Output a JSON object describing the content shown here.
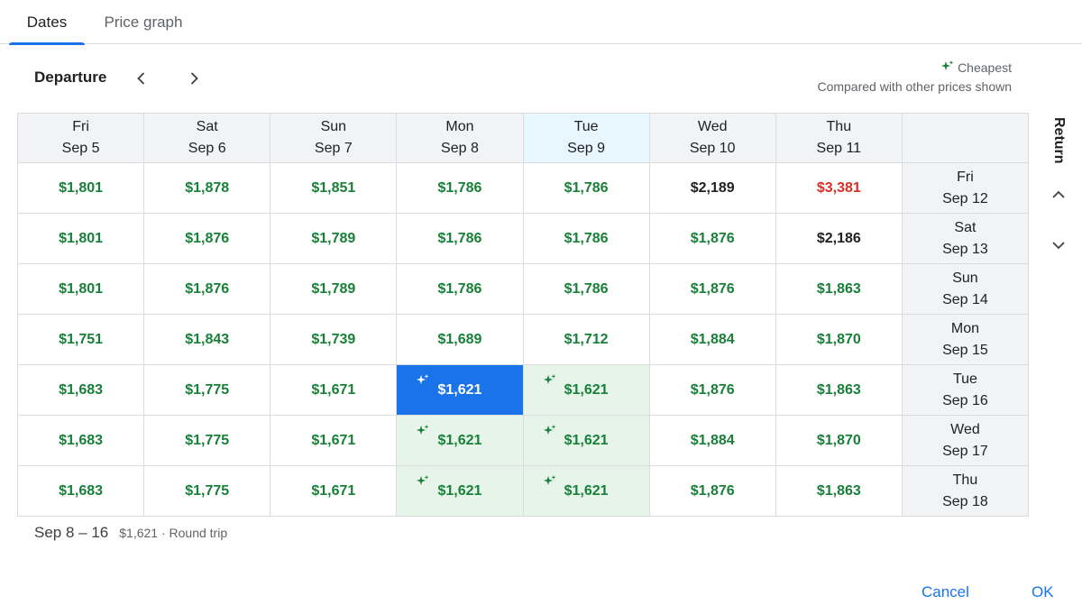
{
  "tabs": [
    {
      "label": "Dates"
    },
    {
      "label": "Price graph"
    }
  ],
  "departure_label": "Departure",
  "legend": {
    "cheapest": "Cheapest",
    "subtitle": "Compared with other prices shown"
  },
  "return_label": "Return",
  "columns": [
    {
      "day": "Fri",
      "date": "Sep 5"
    },
    {
      "day": "Sat",
      "date": "Sep 6"
    },
    {
      "day": "Sun",
      "date": "Sep 7"
    },
    {
      "day": "Mon",
      "date": "Sep 8"
    },
    {
      "day": "Tue",
      "date": "Sep 9"
    },
    {
      "day": "Wed",
      "date": "Sep 10"
    },
    {
      "day": "Thu",
      "date": "Sep 11"
    }
  ],
  "rows": [
    {
      "day": "Fri",
      "date": "Sep 12",
      "prices": [
        "$1,801",
        "$1,878",
        "$1,851",
        "$1,786",
        "$1,786",
        "$2,189",
        "$3,381"
      ],
      "tones": [
        "green",
        "green",
        "green",
        "green",
        "green",
        "black",
        "red"
      ]
    },
    {
      "day": "Sat",
      "date": "Sep 13",
      "prices": [
        "$1,801",
        "$1,876",
        "$1,789",
        "$1,786",
        "$1,786",
        "$1,876",
        "$2,186"
      ],
      "tones": [
        "green",
        "green",
        "green",
        "green",
        "green",
        "green",
        "black"
      ]
    },
    {
      "day": "Sun",
      "date": "Sep 14",
      "prices": [
        "$1,801",
        "$1,876",
        "$1,789",
        "$1,786",
        "$1,786",
        "$1,876",
        "$1,863"
      ],
      "tones": [
        "green",
        "green",
        "green",
        "green",
        "green",
        "green",
        "green"
      ]
    },
    {
      "day": "Mon",
      "date": "Sep 15",
      "prices": [
        "$1,751",
        "$1,843",
        "$1,739",
        "$1,689",
        "$1,712",
        "$1,884",
        "$1,870"
      ],
      "tones": [
        "green",
        "green",
        "green",
        "green",
        "green",
        "green",
        "green"
      ]
    },
    {
      "day": "Tue",
      "date": "Sep 16",
      "prices": [
        "$1,683",
        "$1,775",
        "$1,671",
        "$1,621",
        "$1,621",
        "$1,876",
        "$1,863"
      ],
      "tones": [
        "green",
        "green",
        "green",
        "selected",
        "cheap",
        "green",
        "green"
      ]
    },
    {
      "day": "Wed",
      "date": "Sep 17",
      "prices": [
        "$1,683",
        "$1,775",
        "$1,671",
        "$1,621",
        "$1,621",
        "$1,884",
        "$1,870"
      ],
      "tones": [
        "green",
        "green",
        "green",
        "cheap",
        "cheap",
        "green",
        "green"
      ]
    },
    {
      "day": "Thu",
      "date": "Sep 18",
      "prices": [
        "$1,683",
        "$1,775",
        "$1,671",
        "$1,621",
        "$1,621",
        "$1,876",
        "$1,863"
      ],
      "tones": [
        "green",
        "green",
        "green",
        "cheap",
        "cheap",
        "green",
        "green"
      ]
    }
  ],
  "summary": {
    "dates": "Sep 8 – 16",
    "price": "$1,621 · Round trip"
  },
  "buttons": {
    "cancel": "Cancel",
    "ok": "OK"
  },
  "colors": {
    "accent": "#1a73e8",
    "cheap_green": "#188038",
    "expensive_red": "#d93025",
    "cheap_bg": "#e6f4ea"
  }
}
